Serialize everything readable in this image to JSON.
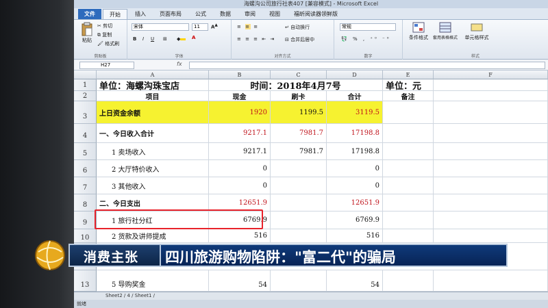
{
  "window": {
    "title": "海螺沟公司旅行社表407 [兼容模式] - Microsoft Excel"
  },
  "tabs": [
    "文件",
    "开始",
    "插入",
    "页面布局",
    "公式",
    "数据",
    "审阅",
    "视图",
    "福昕阅读器领鲜版"
  ],
  "ribbon": {
    "clipboard": {
      "paste": "粘贴",
      "cut": "剪切",
      "copy": "复制",
      "format_painter": "格式刷",
      "label": "剪贴板"
    },
    "font": {
      "name": "宋体",
      "size": "11",
      "label": "字体"
    },
    "alignment": {
      "wrap": "自动换行",
      "merge": "合并后居中",
      "label": "对齐方式"
    },
    "number": {
      "format": "常规",
      "label": "数字"
    },
    "styles": {
      "conditional": "条件格式",
      "table": "套用表格格式",
      "cell": "单元格样式",
      "label": "样式"
    }
  },
  "formula_bar": {
    "name_box": "H27",
    "fx": "fx",
    "content": ""
  },
  "columns": [
    "A",
    "B",
    "C",
    "D",
    "E",
    "F"
  ],
  "rows": [
    {
      "num": "1",
      "cells": [
        "单位：海螺沟珠宝店",
        "时间：2018年4月7号",
        "",
        "",
        "单位：元",
        ""
      ]
    },
    {
      "num": "2",
      "cells": [
        "项目",
        "现金",
        "刷卡",
        "合计",
        "备注",
        ""
      ]
    },
    {
      "num": "3",
      "cells": [
        "上日资金余额",
        "1920",
        "1199.5",
        "3119.5",
        "",
        ""
      ]
    },
    {
      "num": "4",
      "cells": [
        "一、今日收入合计",
        "9217.1",
        "7981.7",
        "17198.8",
        "",
        ""
      ]
    },
    {
      "num": "5",
      "cells": [
        "1 卖场收入",
        "9217.1",
        "7981.7",
        "17198.8",
        "",
        ""
      ]
    },
    {
      "num": "6",
      "cells": [
        "2 大厅特价收入",
        "0",
        "",
        "0",
        "",
        ""
      ]
    },
    {
      "num": "7",
      "cells": [
        "3 其他收入",
        "0",
        "",
        "0",
        "",
        ""
      ]
    },
    {
      "num": "8",
      "cells": [
        "二、今日支出",
        "12651.9",
        "",
        "12651.9",
        "",
        ""
      ]
    },
    {
      "num": "9",
      "cells": [
        "1 旅行社分红",
        "6769.9",
        "",
        "6769.9",
        "",
        ""
      ]
    },
    {
      "num": "10",
      "cells": [
        "2 货款及讲师提成",
        "516",
        "",
        "516",
        "",
        ""
      ]
    },
    {
      "num": "11",
      "cells": [
        "",
        "",
        "",
        "",
        "",
        ""
      ]
    },
    {
      "num": "12",
      "cells": [
        "",
        "",
        "",
        "",
        "",
        ""
      ]
    },
    {
      "num": "13",
      "cells": [
        "5 导购奖金",
        "54",
        "",
        "54",
        "",
        ""
      ]
    }
  ],
  "sheet_tabs": "Sheet2 / 4 / Sheet1 / ",
  "status": "就绪",
  "banner": {
    "left": "消费主张",
    "right": "四川旅游购物陷阱：\"富二代\"的骗局"
  },
  "colors": {
    "highlight_yellow": "#f6f230",
    "red_text": "#c0141c",
    "annotation_red": "#e8222a",
    "banner_blue": "#0f3a7a"
  }
}
